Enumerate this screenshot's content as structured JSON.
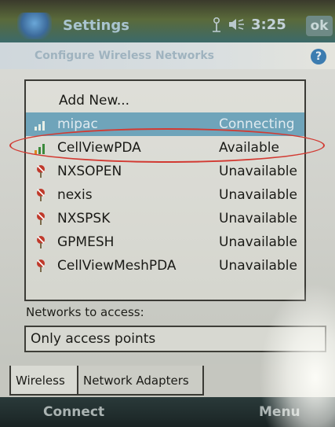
{
  "titlebar": {
    "title": "Settings",
    "time": "3:25",
    "ok_label": "ok",
    "icons": [
      "windows-start-icon",
      "connectivity-icon",
      "volume-icon"
    ]
  },
  "header": {
    "title": "Configure Wireless Networks",
    "help_icon": "help-icon",
    "help_glyph": "?"
  },
  "network_list": {
    "add_new_label": "Add New...",
    "networks": [
      {
        "name": "mipac",
        "status": "Connecting",
        "icon": "signal-bars-icon"
      },
      {
        "name": "CellViewPDA",
        "status": "Available",
        "icon": "signal-bars-icon"
      },
      {
        "name": "NXSOPEN",
        "status": "Unavailable",
        "icon": "antenna-unavailable-icon"
      },
      {
        "name": "nexis",
        "status": "Unavailable",
        "icon": "antenna-unavailable-icon"
      },
      {
        "name": "NXSPSK",
        "status": "Unavailable",
        "icon": "antenna-unavailable-icon"
      },
      {
        "name": "GPMESH",
        "status": "Unavailable",
        "icon": "antenna-unavailable-icon"
      },
      {
        "name": "CellViewMeshPDA",
        "status": "Unavailable",
        "icon": "antenna-unavailable-icon"
      }
    ]
  },
  "access": {
    "label": "Networks to access:",
    "selected_value": "Only access points"
  },
  "tabs": [
    {
      "label": "Wireless",
      "active": true
    },
    {
      "label": "Network Adapters",
      "active": false
    }
  ],
  "softkeys": {
    "left": "Connect",
    "right": "Menu"
  },
  "colors": {
    "selected_row": "#6fa4ba",
    "highlight_ellipse": "#d23a32",
    "unavailable_icon": "#c0392b"
  }
}
